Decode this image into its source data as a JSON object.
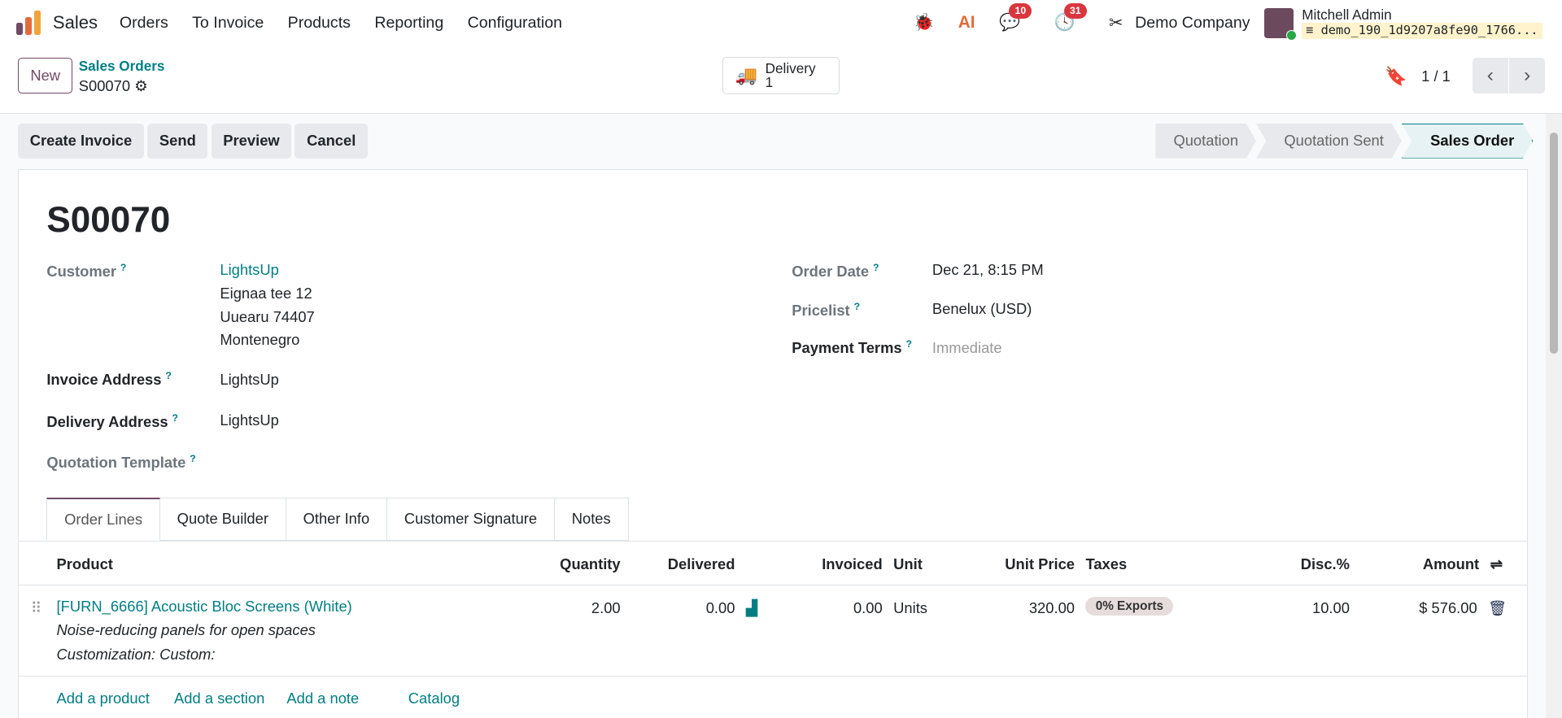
{
  "navbar": {
    "app": "Sales",
    "menu": [
      "Orders",
      "To Invoice",
      "Products",
      "Reporting",
      "Configuration"
    ],
    "messages_count": "10",
    "activities_count": "31",
    "company": "Demo Company",
    "user": "Mitchell Admin",
    "database": "demo_190_1d9207a8fe90_1766..."
  },
  "control": {
    "new_label": "New",
    "breadcrumb": "Sales Orders",
    "record": "S00070",
    "delivery_label": "Delivery",
    "delivery_count": "1",
    "pager": "1 / 1"
  },
  "actions": [
    "Create Invoice",
    "Send",
    "Preview",
    "Cancel"
  ],
  "statusbar": {
    "steps": [
      "Quotation",
      "Quotation Sent",
      "Sales Order"
    ],
    "active": "Sales Order"
  },
  "form": {
    "title": "S00070",
    "customer_label": "Customer",
    "customer": "LightsUp",
    "address": [
      "Eignaa tee 12",
      "Uuearu 74407",
      "Montenegro"
    ],
    "invoice_address_label": "Invoice Address",
    "invoice_address": "LightsUp",
    "delivery_address_label": "Delivery Address",
    "delivery_address": "LightsUp",
    "quotation_template_label": "Quotation Template",
    "order_date_label": "Order Date",
    "order_date": "Dec 21, 8:15 PM",
    "pricelist_label": "Pricelist",
    "pricelist": "Benelux (USD)",
    "payment_terms_label": "Payment Terms",
    "payment_terms_placeholder": "Immediate",
    "help": "?"
  },
  "tabs": [
    "Order Lines",
    "Quote Builder",
    "Other Info",
    "Customer Signature",
    "Notes"
  ],
  "table": {
    "headers": {
      "product": "Product",
      "quantity": "Quantity",
      "delivered": "Delivered",
      "invoiced": "Invoiced",
      "unit": "Unit",
      "unit_price": "Unit Price",
      "taxes": "Taxes",
      "disc": "Disc.%",
      "amount": "Amount"
    },
    "rows": [
      {
        "product": "[FURN_6666] Acoustic Bloc Screens (White)",
        "description": "Noise-reducing panels for open spaces",
        "customization": "Customization: Custom:",
        "quantity": "2.00",
        "delivered": "0.00",
        "invoiced": "0.00",
        "unit": "Units",
        "unit_price": "320.00",
        "tax": "0% Exports",
        "disc": "10.00",
        "amount": "$ 576.00"
      }
    ]
  },
  "add_links": [
    "Add a product",
    "Add a section",
    "Add a note",
    "Catalog"
  ]
}
